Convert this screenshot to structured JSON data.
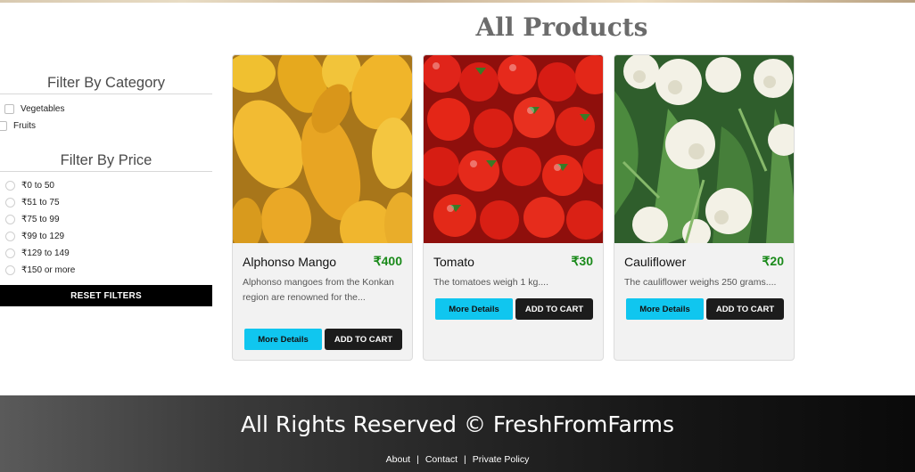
{
  "page": {
    "title": "All Products"
  },
  "sidebar": {
    "category_heading": "Filter By Category",
    "categories": [
      "Vegetables",
      "Fruits"
    ],
    "price_heading": "Filter By Price",
    "prices": [
      "₹0 to 50",
      "₹51 to 75",
      "₹75 to 99",
      "₹99 to 129",
      "₹129 to 149",
      "₹150 or more"
    ],
    "reset_label": "RESET FILTERS"
  },
  "products": [
    {
      "name": "Alphonso Mango",
      "price": "₹400",
      "description": "Alphonso mangoes from the Konkan region are renowned for the...",
      "image": "mango-image"
    },
    {
      "name": "Tomato",
      "price": "₹30",
      "description": "The tomatoes weigh 1 kg....",
      "image": "tomato-image"
    },
    {
      "name": "Cauliflower",
      "price": "₹20",
      "description": "The cauliflower weighs 250 grams....",
      "image": "cauliflower-image"
    }
  ],
  "buttons": {
    "more_details": "More Details",
    "add_to_cart": "ADD TO CART"
  },
  "footer": {
    "title": "All Rights Reserved © FreshFromFarms",
    "links": [
      "About",
      "Contact",
      "Private Policy"
    ],
    "separator": "|"
  },
  "colors": {
    "accent_cyan": "#10c6ef",
    "price_green": "#1a8a1a",
    "button_dark": "#1c1c1c"
  }
}
